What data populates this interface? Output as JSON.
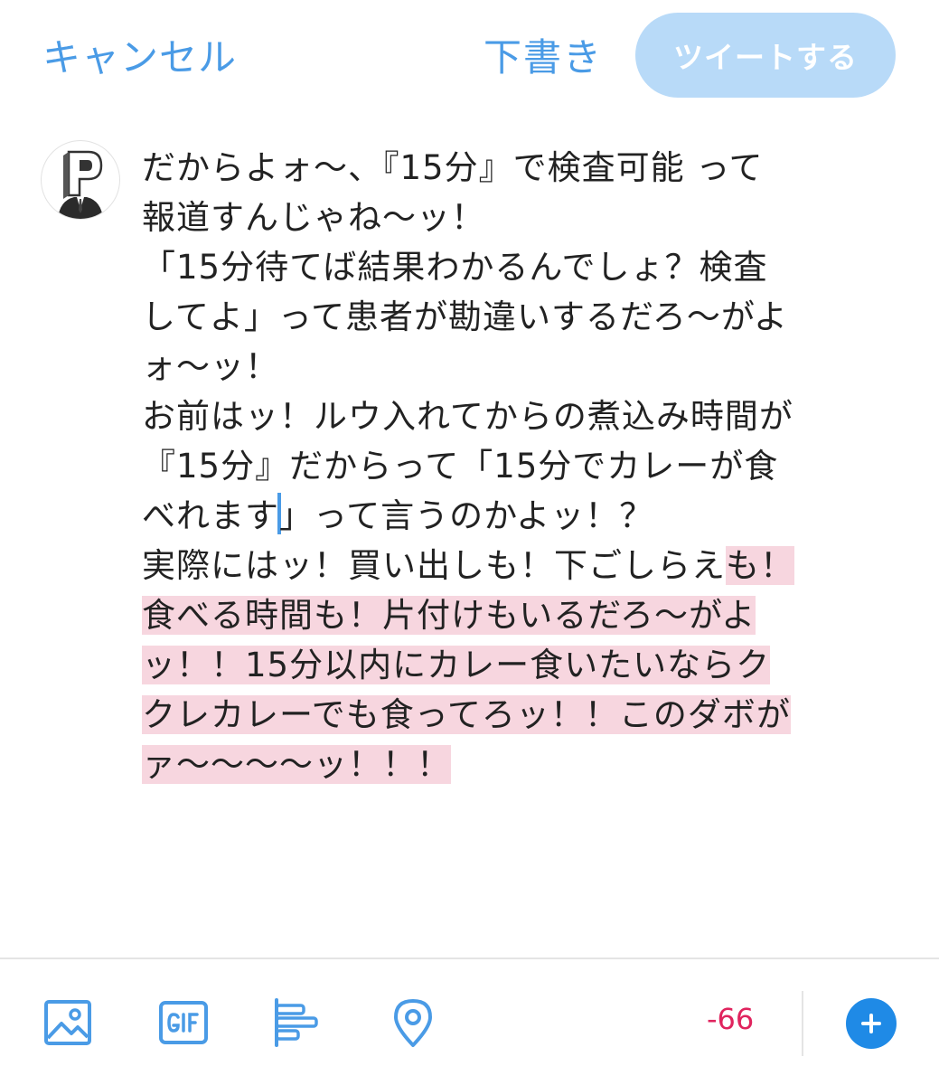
{
  "header": {
    "cancel_label": "キャンセル",
    "draft_label": "下書き",
    "tweet_label": "ツイートする"
  },
  "composer": {
    "lines": [
      {
        "text": "だからよォ〜、『15分』で検査可能 って"
      },
      {
        "text": "報道すんじゃね〜ッ！"
      },
      {
        "text": "「15分待てば結果わかるんでしょ？検査"
      },
      {
        "text": "してよ」って患者が勘違いするだろ〜がよ"
      },
      {
        "text": "ォ〜ッ！"
      },
      {
        "text": "お前はッ！ルウ入れてからの煮込み時間が"
      },
      {
        "text": "『15分』だからって「15分でカレーが食"
      },
      {
        "before": "べれます",
        "after": "」って言うのかよッ！？"
      },
      {
        "plain": "実際にはッ！買い出しも！下ごしらえ",
        "hl": "も！"
      },
      {
        "hl": "食べる時間も！片付けもいるだろ〜がよ"
      },
      {
        "hl": "ッ！！15分以内にカレー食いたいならク"
      },
      {
        "hl": "クレカレーでも食ってろッ！！このダボが"
      },
      {
        "hl": "ァ〜〜〜〜ッ！！！"
      }
    ]
  },
  "toolbar": {
    "icons": [
      "image-icon",
      "gif-icon",
      "poll-icon",
      "location-icon"
    ],
    "char_count": "-66",
    "add_icon": "plus-icon"
  },
  "colors": {
    "accent": "#4a9be6",
    "tweet_button_disabled": "#b8daf8",
    "highlight": "#f7d6df",
    "counter_over_limit": "#e0245e",
    "add_button": "#1f8ae6"
  }
}
